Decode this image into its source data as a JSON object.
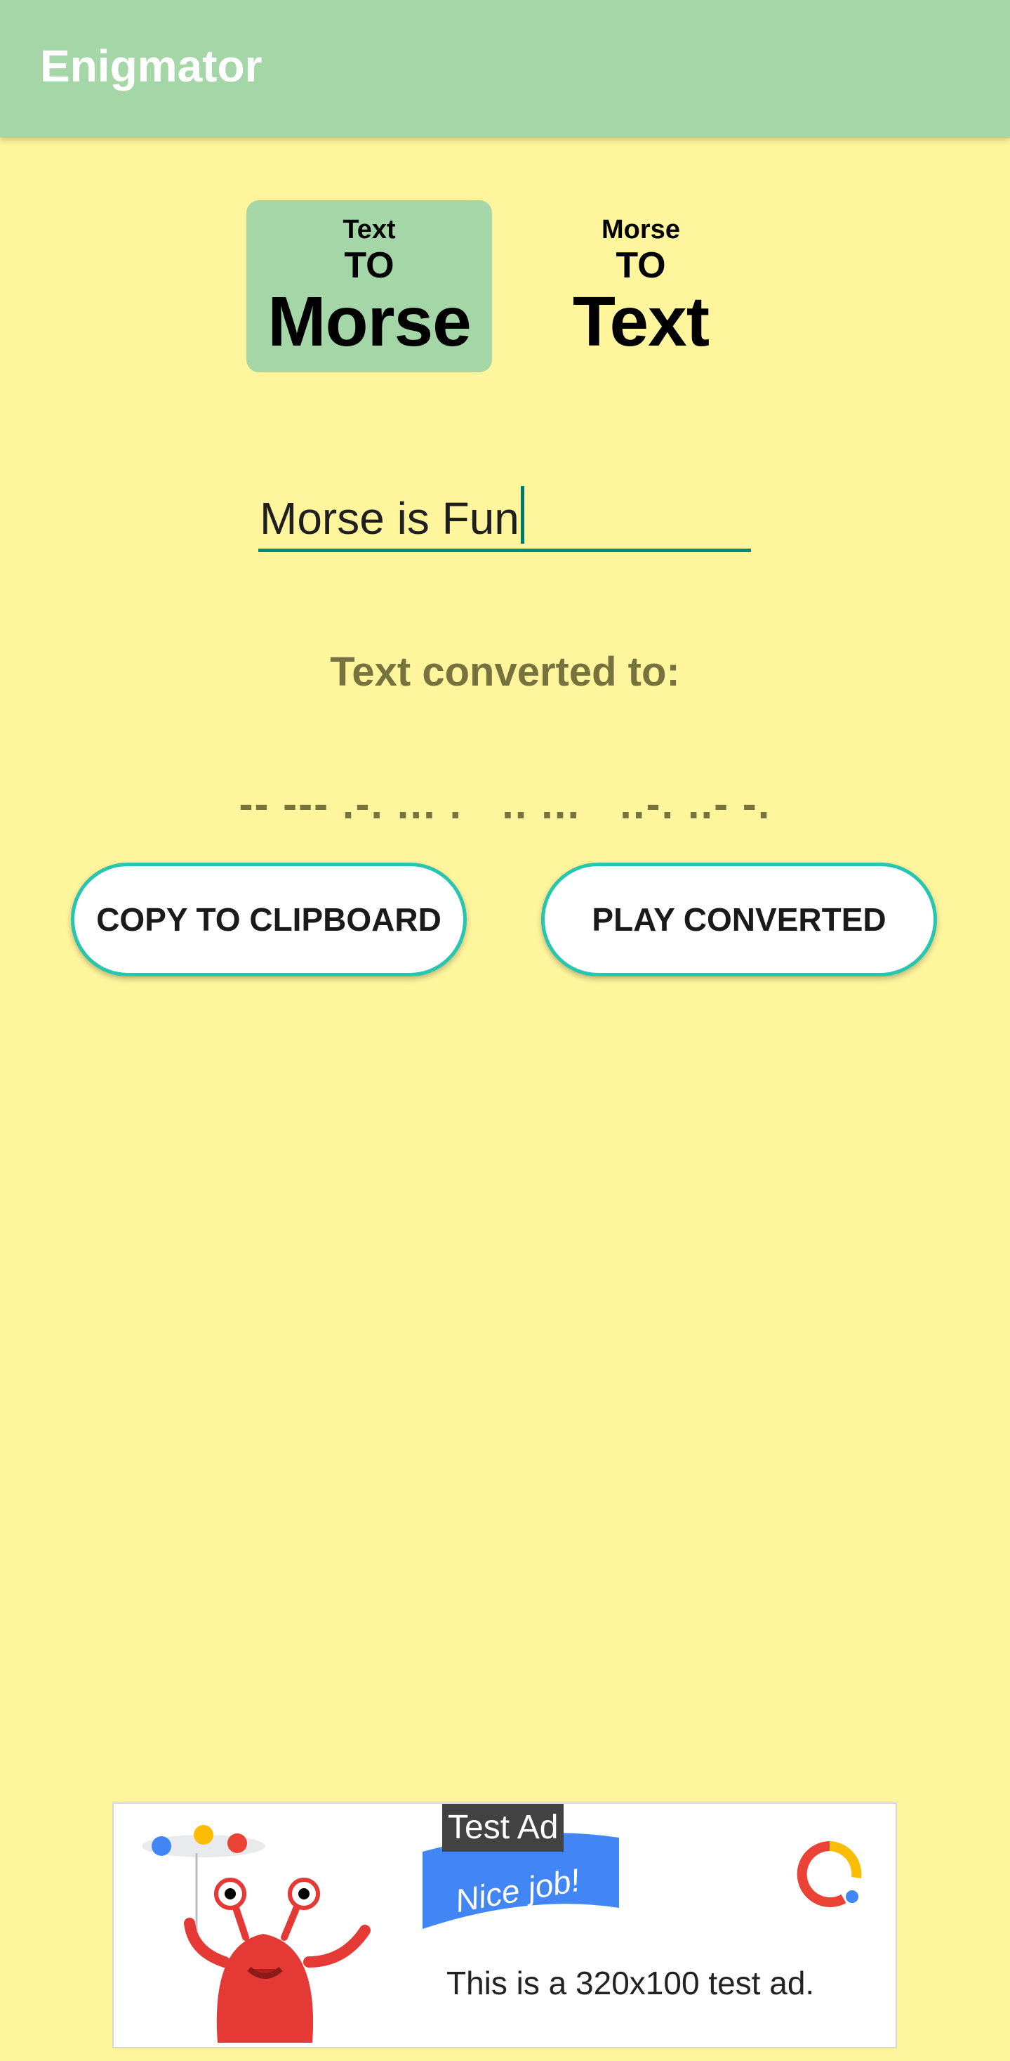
{
  "appbar": {
    "title": "Enigmator"
  },
  "modes": {
    "text_to_morse": {
      "top": "Text",
      "mid": "TO",
      "bottom": "Morse",
      "selected": true
    },
    "morse_to_text": {
      "top": "Morse",
      "mid": "TO",
      "bottom": "Text",
      "selected": false
    }
  },
  "input": {
    "value": "Morse is Fun"
  },
  "output": {
    "label": "Text converted to:",
    "morse": "-- --- .-. ... .   .. ...   ..-. ..- -."
  },
  "buttons": {
    "copy": "COPY TO CLIPBOARD",
    "play": "PLAY CONVERTED"
  },
  "ad": {
    "badge": "Test Ad",
    "flag_text": "Nice job!",
    "text": "This is a 320x100 test ad."
  },
  "colors": {
    "background": "#FFF59D",
    "appbar": "#A5D6A7",
    "accent": "#00897B",
    "button_border": "#26C6B0",
    "label_text": "#77733F"
  }
}
